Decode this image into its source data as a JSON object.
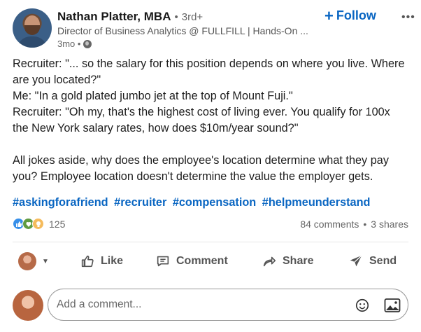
{
  "author": {
    "name": "Nathan Platter, MBA",
    "separator": "•",
    "degree": "3rd+",
    "headline": "Director of Business Analytics @ FULLFILL | Hands-On ...",
    "time": "3mo •"
  },
  "header": {
    "follow_label": "Follow",
    "follow_plus": "+",
    "more_label": "•••"
  },
  "post": {
    "lines": [
      "Recruiter: \"... so the salary for this position depends on where you live. Where are you located?\"",
      "Me: \"In a gold plated jumbo jet at the top of Mount Fuji.\"",
      "Recruiter: \"Oh my, that's the highest cost of living ever. You qualify for 100x the New York salary rates, how does $10m/year sound?\"",
      "All jokes aside, why does the employee's location determine what they pay you? Employee location doesn't determine the value the employer gets."
    ],
    "hashtags": [
      "#askingforafriend",
      "#recruiter",
      "#compensation",
      "#helpmeunderstand"
    ]
  },
  "social": {
    "reaction_count": "125",
    "comments": "84 comments",
    "dot": "•",
    "shares": "3 shares"
  },
  "actions": {
    "like": "Like",
    "comment": "Comment",
    "share": "Share",
    "send": "Send"
  },
  "composer": {
    "placeholder": "Add a comment..."
  },
  "colors": {
    "accent": "#0a66c2",
    "text": "#191919",
    "muted": "#666666"
  }
}
